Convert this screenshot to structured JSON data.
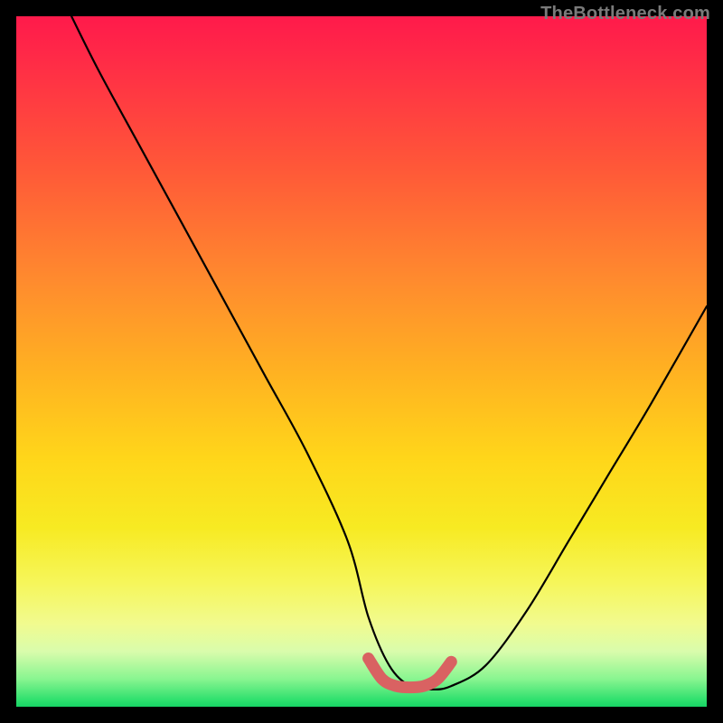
{
  "watermark": "TheBottleneck.com",
  "colors": {
    "frame": "#000000",
    "curve": "#000000",
    "marker": "#d96262",
    "gradient_stops": [
      {
        "pos": 0,
        "hex": "#ff1a4b"
      },
      {
        "pos": 6,
        "hex": "#ff2a47"
      },
      {
        "pos": 22,
        "hex": "#ff5838"
      },
      {
        "pos": 38,
        "hex": "#ff8a2e"
      },
      {
        "pos": 52,
        "hex": "#ffb321"
      },
      {
        "pos": 64,
        "hex": "#ffd61a"
      },
      {
        "pos": 74,
        "hex": "#f7ea22"
      },
      {
        "pos": 82,
        "hex": "#f6f65a"
      },
      {
        "pos": 88,
        "hex": "#f1fb8f"
      },
      {
        "pos": 92,
        "hex": "#d9fcac"
      },
      {
        "pos": 96,
        "hex": "#88f590"
      },
      {
        "pos": 99,
        "hex": "#2fe06e"
      },
      {
        "pos": 100,
        "hex": "#17d465"
      }
    ]
  },
  "chart_data": {
    "type": "line",
    "title": "",
    "xlabel": "",
    "ylabel": "",
    "xlim": [
      0,
      100
    ],
    "ylim": [
      0,
      100
    ],
    "series": [
      {
        "name": "bottleneck-curve",
        "x": [
          8,
          12,
          18,
          24,
          30,
          36,
          42,
          48,
          51,
          54,
          57,
          60,
          63,
          68,
          74,
          80,
          86,
          92,
          100
        ],
        "y": [
          100,
          92,
          81,
          70,
          59,
          48,
          37,
          24,
          13,
          6,
          3,
          2.5,
          3,
          6,
          14,
          24,
          34,
          44,
          58
        ]
      }
    ],
    "marker_segment": {
      "name": "optimal-range",
      "x": [
        51,
        53,
        55,
        57,
        59,
        61,
        63
      ],
      "y": [
        7,
        4,
        3,
        2.8,
        3,
        4,
        6.5
      ]
    }
  }
}
